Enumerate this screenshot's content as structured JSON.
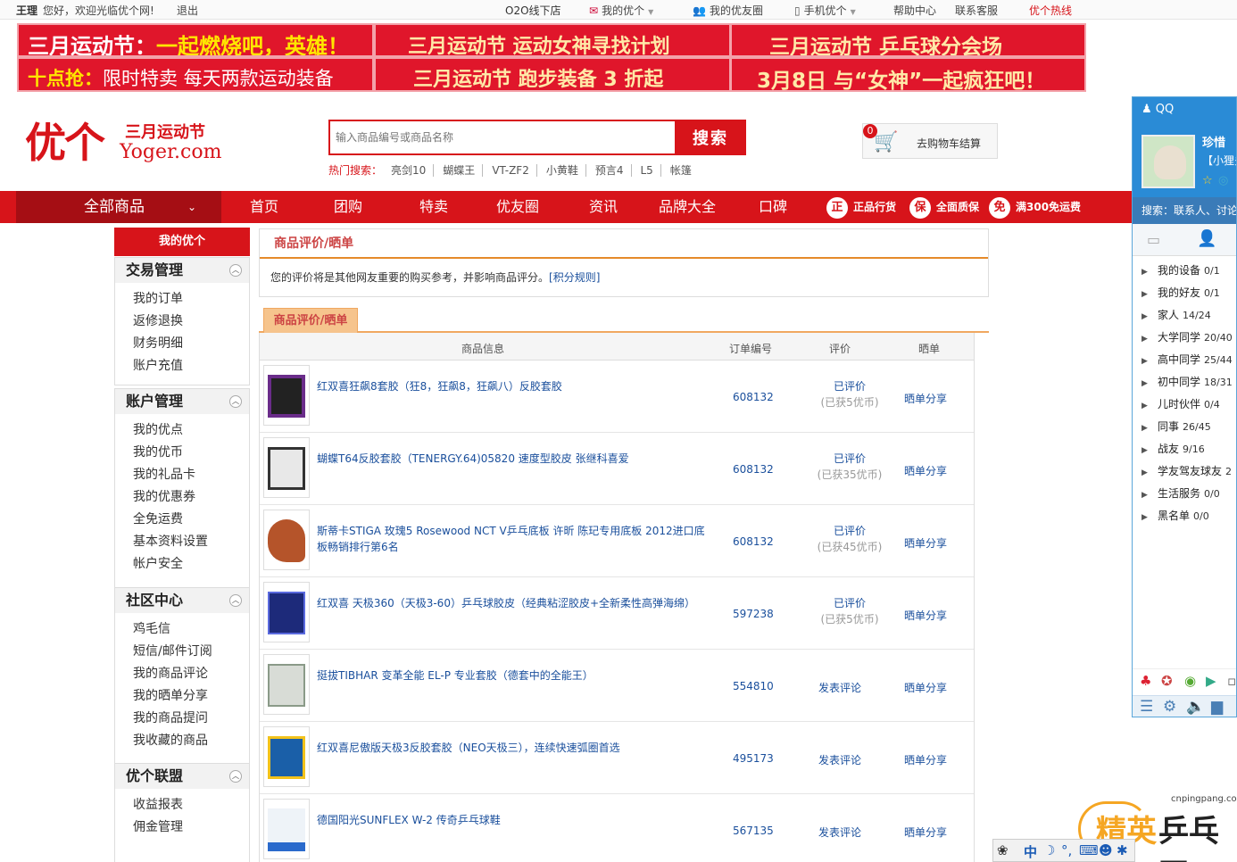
{
  "topbar": {
    "user": "王理",
    "welcome": "您好，欢迎光临优个网!",
    "logout": "退出",
    "o2o": "O2O线下店",
    "my_yoger": "我的优个",
    "my_friends": "我的优友圈",
    "mobile": "手机优个",
    "help": "帮助中心",
    "contact": "联系客服",
    "hotline": "优个热线"
  },
  "banners": {
    "b1_prefix": "三月运动节：",
    "b1_highlight": "一起燃烧吧，英雄！",
    "b2": "三月运动节  运动女神寻找计划",
    "b3": "三月运动节  乒乓球分会场",
    "b4_key": "十点抢：",
    "b4_rest": "限时特卖   每天两款运动装备",
    "b5": "三月运动节  跑步装备 3 折起",
    "b6": "3月8日 与“女神”一起疯狂吧！"
  },
  "logo": {
    "main": "优个",
    "sub": "三月运动节",
    "url": "Yoger.com"
  },
  "search": {
    "placeholder": "输入商品编号或商品名称",
    "button": "搜索",
    "hot_label": "热门搜索：",
    "hot_keywords": [
      "亮剑10",
      "蝴蝶王",
      "VT-ZF2",
      "小黄鞋",
      "预言4",
      "L5",
      "帐篷"
    ]
  },
  "cart": {
    "count": "0",
    "label": "去购物车结算"
  },
  "nav": {
    "all_products": "全部商品",
    "items": [
      "首页",
      "团购",
      "特卖",
      "优友圈",
      "资讯",
      "品牌大全",
      "口碑"
    ],
    "badges": [
      {
        "icon": "正",
        "label": "正品行货"
      },
      {
        "icon": "保",
        "label": "全面质保"
      },
      {
        "icon": "免",
        "label": "满300免运费"
      }
    ]
  },
  "sidebar": {
    "title": "我的优个",
    "groups": [
      {
        "title": "交易管理",
        "links": [
          "我的订单",
          "返修退换",
          "财务明细",
          "账户充值"
        ]
      },
      {
        "title": "账户管理",
        "links": [
          "我的优点",
          "我的优币",
          "我的礼品卡",
          "我的优惠券",
          "全免运费",
          "基本资料设置",
          "帐户安全"
        ]
      },
      {
        "title": "社区中心",
        "links": [
          "鸡毛信",
          "短信/邮件订阅",
          "我的商品评论",
          "我的晒单分享",
          "我的商品提问",
          "我收藏的商品"
        ]
      },
      {
        "title": "优个联盟",
        "links": [
          "收益报表",
          "佣金管理"
        ]
      }
    ]
  },
  "main": {
    "panel_title": "商品评价/晒单",
    "notice": "您的评价将是其他网友重要的购买参考，并影响商品评分。",
    "notice_link": "[积分规则]",
    "tab": "商品评价/晒单",
    "columns": [
      "商品信息",
      "订单编号",
      "评价",
      "晒单"
    ],
    "rows": [
      {
        "name": "红双喜狂飙8套胶（狂8，狂飙8，狂飙八）反胶套胶",
        "order": "608132",
        "review": "已评价",
        "review_sub": "(已获5优币)",
        "share": "晒单分享"
      },
      {
        "name": "蝴蝶T64反胶套胶（TENERGY.64)05820 速度型胶皮 张继科喜爱",
        "order": "608132",
        "review": "已评价",
        "review_sub": "(已获35优币)",
        "share": "晒单分享"
      },
      {
        "name": "斯蒂卡STIGA 玫瑰5 Rosewood NCT V乒乓底板 许昕 陈玘专用底板 2012进口底板畅销排行第6名",
        "order": "608132",
        "review": "已评价",
        "review_sub": "(已获45优币)",
        "share": "晒单分享"
      },
      {
        "name": "红双喜 天极360（天极3-60）乒乓球胶皮（经典粘涩胶皮+全新柔性高弹海绵）",
        "order": "597238",
        "review": "已评价",
        "review_sub": "(已获5优币)",
        "share": "晒单分享"
      },
      {
        "name": "挺拔TIBHAR 变革全能 EL-P 专业套胶（德套中的全能王）",
        "order": "554810",
        "review": "发表评论",
        "review_sub": "",
        "share": "晒单分享"
      },
      {
        "name": "红双喜尼傲版天极3反胶套胶（NEO天极三），连续快速弧圈首选",
        "order": "495173",
        "review": "发表评论",
        "review_sub": "",
        "share": "晒单分享"
      },
      {
        "name": "德国阳光SUNFLEX W-2 传奇乒乓球鞋",
        "order": "567135",
        "review": "发表评论",
        "review_sub": "",
        "share": "晒单分享"
      }
    ]
  },
  "qq": {
    "title": "QQ",
    "nickname": "珍惜",
    "signature": "【小狸多",
    "search": "搜索：联系人、讨论",
    "groups": [
      {
        "name": "我的设备",
        "count": "0/1"
      },
      {
        "name": "我的好友",
        "count": "0/1"
      },
      {
        "name": "家人",
        "count": "14/24"
      },
      {
        "name": "大学同学",
        "count": "20/40"
      },
      {
        "name": "高中同学",
        "count": "25/44"
      },
      {
        "name": "初中同学",
        "count": "18/31"
      },
      {
        "name": "儿时伙伴",
        "count": "0/4"
      },
      {
        "name": "同事",
        "count": "26/45"
      },
      {
        "name": "战友",
        "count": "9/16"
      },
      {
        "name": "学友驾友球友",
        "count": "2"
      },
      {
        "name": "生活服务",
        "count": "0/0"
      },
      {
        "name": "黑名单",
        "count": "0/0"
      }
    ]
  },
  "watermark": {
    "url": "cnpingpang.com",
    "brand_a": "精英",
    "brand_b": "乒乓网"
  },
  "ime": {
    "mode": "中"
  }
}
